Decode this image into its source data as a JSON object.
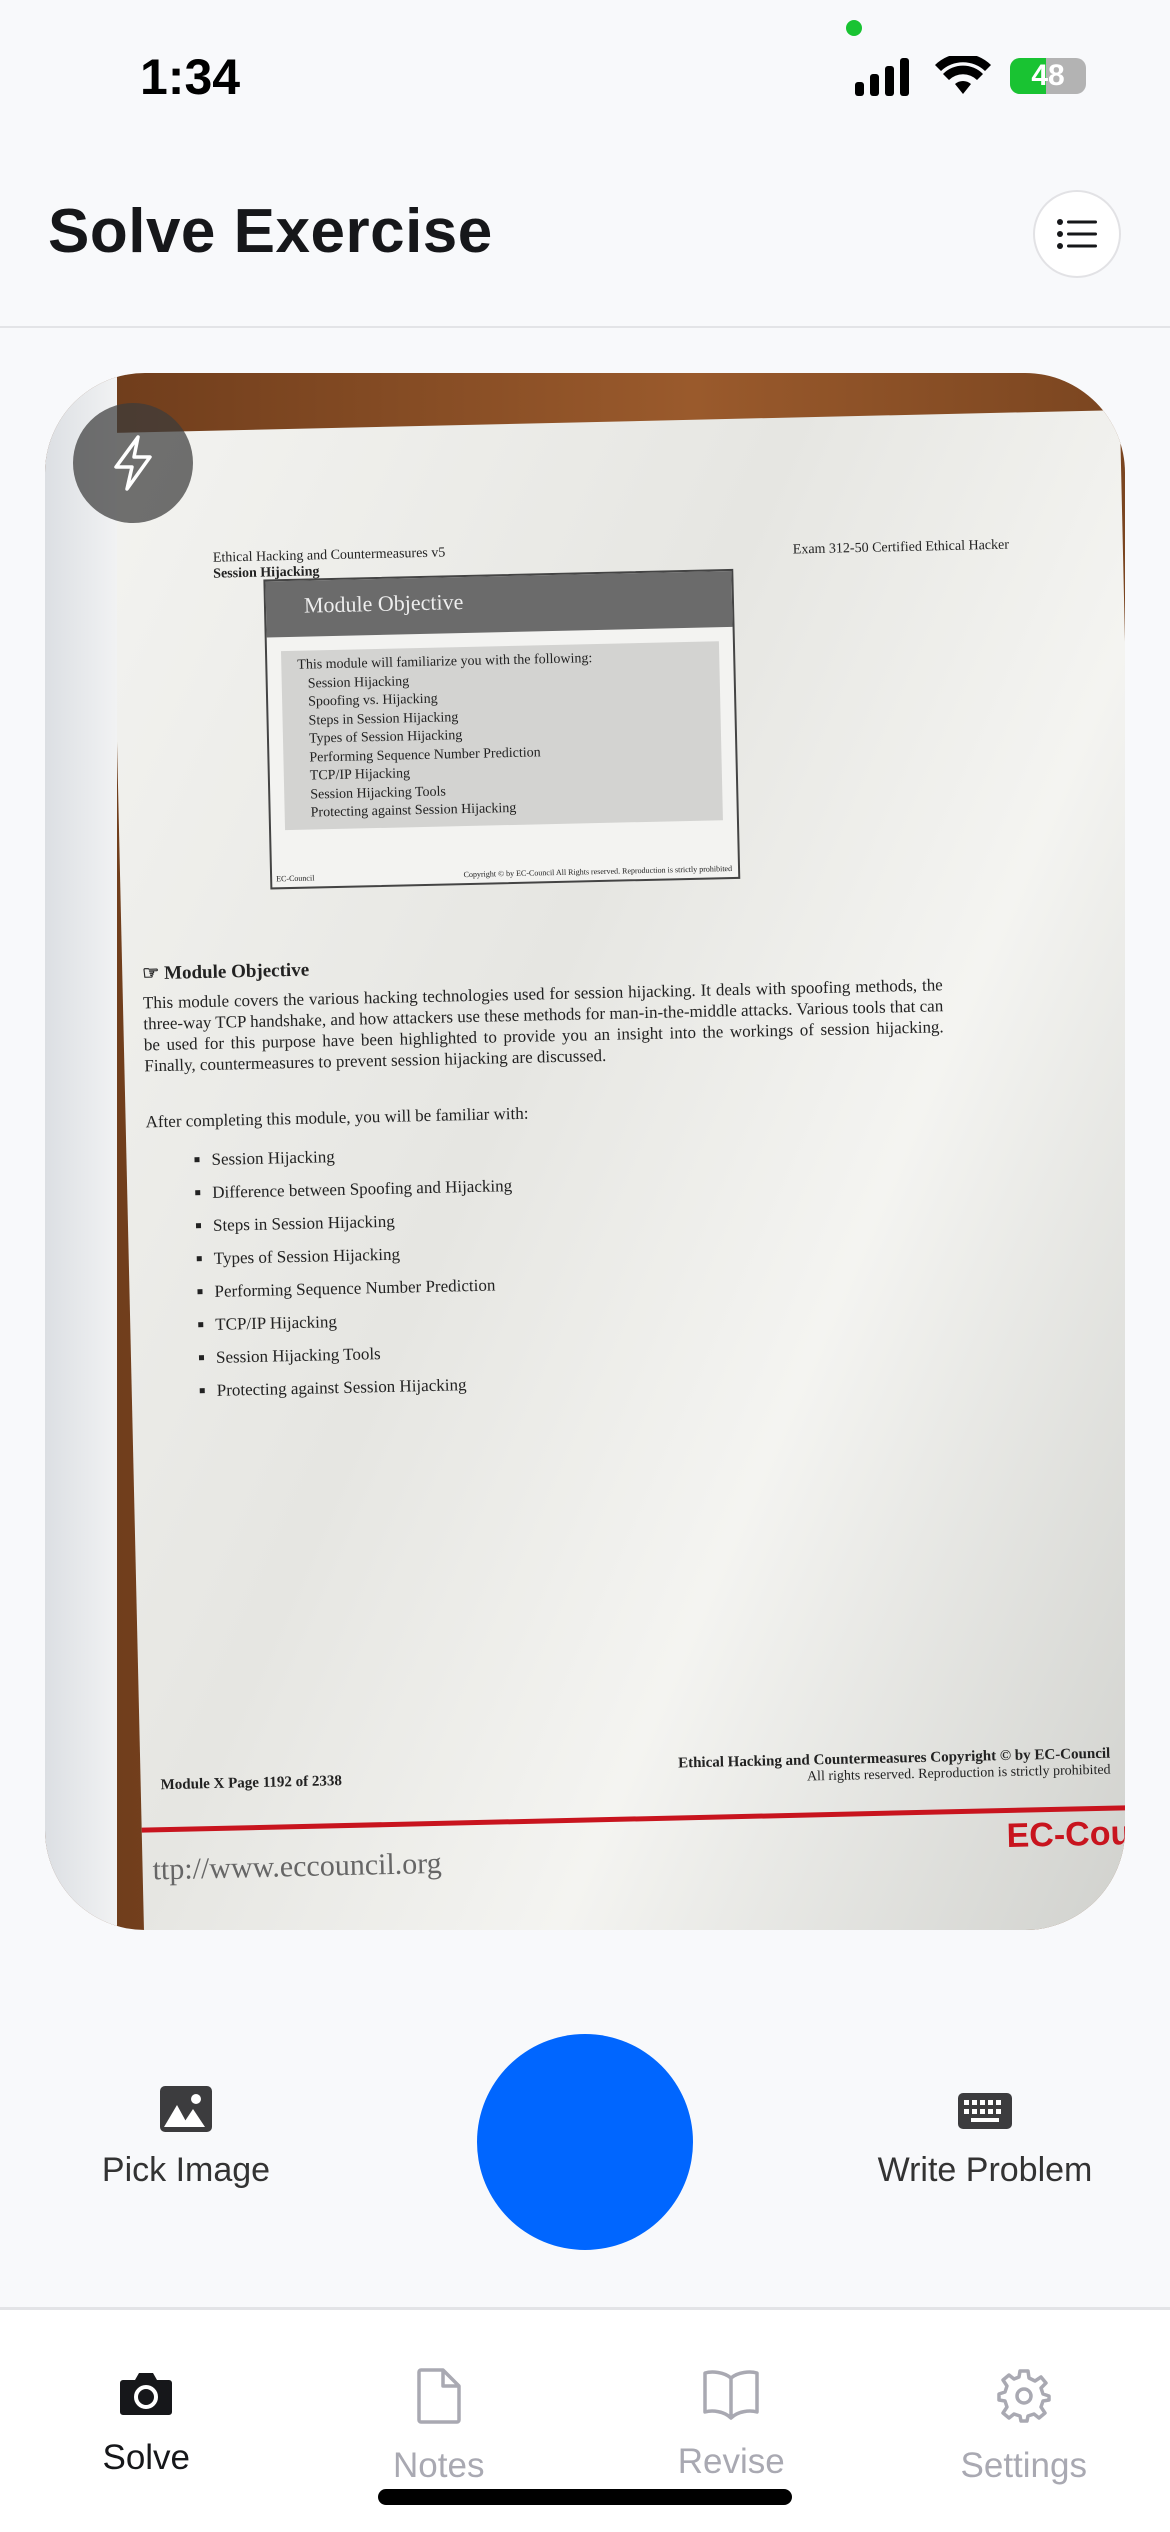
{
  "status": {
    "time": "1:34",
    "battery": "48",
    "battery_level_percent": 48,
    "charging": true
  },
  "header": {
    "title": "Solve Exercise",
    "menu_icon": "list-icon"
  },
  "preview": {
    "flash_icon": "lightning-bolt-icon",
    "document": {
      "header_left_1": "Ethical Hacking and Countermeasures v5",
      "header_left_2": "Session Hijacking",
      "header_right": "Exam 312-50 Certified Ethical Hacker",
      "slide_title": "Module Objective",
      "slide_intro": "This module will familiarize you with the following:",
      "slide_items": [
        "Session Hijacking",
        "Spoofing vs. Hijacking",
        "Steps in Session Hijacking",
        "Types of Session Hijacking",
        "Performing Sequence Number Prediction",
        "TCP/IP Hijacking",
        "Session Hijacking Tools",
        "Protecting against Session Hijacking"
      ],
      "slide_footer_left": "EC-Council",
      "slide_footer_right": "Copyright © by EC-Council All Rights reserved. Reproduction is strictly prohibited",
      "section_title": "Module Objective",
      "paragraph": "This module covers the various hacking technologies used for session hijacking. It deals with spoofing methods, the three-way TCP handshake, and how attackers use these methods for man-in-the-middle attacks. Various tools that can be used for this purpose have been highlighted to provide you an insight into the workings of session hijacking. Finally, countermeasures to prevent session hijacking are discussed.",
      "after_text": "After completing this module, you will be familiar with:",
      "bullets": [
        "Session Hijacking",
        "Difference between Spoofing and Hijacking",
        "Steps in Session Hijacking",
        "Types of Session Hijacking",
        "Performing Sequence Number Prediction",
        "TCP/IP Hijacking",
        "Session Hijacking Tools",
        "Protecting against Session Hijacking"
      ],
      "footer_left": "Module X Page 1192 of 2338",
      "footer_right_1": "Ethical Hacking and Countermeasures Copyright © by EC-Council",
      "footer_right_2": "All rights reserved. Reproduction is strictly prohibited",
      "logo": "EC-Coun",
      "url": "ttp://www.eccouncil.org"
    }
  },
  "actions": {
    "pick_image": "Pick Image",
    "write_problem": "Write Problem",
    "shutter_color": "#0066ff"
  },
  "tabs": [
    {
      "label": "Solve",
      "active": true
    },
    {
      "label": "Notes"
    },
    {
      "label": "Revise"
    },
    {
      "label": "Settings"
    }
  ]
}
